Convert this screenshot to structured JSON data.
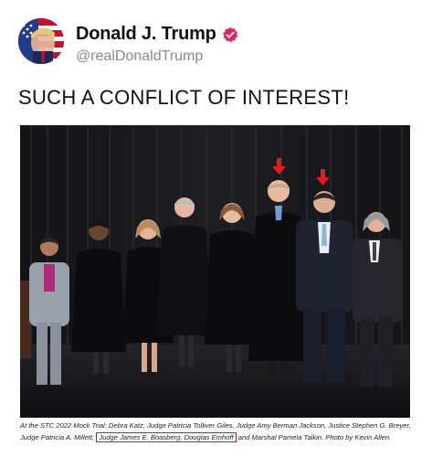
{
  "post": {
    "display_name": "Donald J. Trump",
    "handle": "@realDonaldTrump",
    "verified_icon": "verified-badge-icon",
    "text": "SUCH A CONFLICT OF INTEREST!"
  },
  "photo": {
    "marker_color": "#e21b1b",
    "caption_part1": "At the STC 2022 Mock Trial: Debra Katz, Judge Patricia Tolliver Giles, Judge Amy Berman Jackson, Justice Stephen G. Breyer,",
    "caption_part2": "Judge Patricia A. Millett,",
    "caption_highlight": "Judge James E. Boasberg, Douglas Emhoff",
    "caption_part3": "and Marshal Pamela Talkin. Photo by Kevin Allen."
  },
  "colors": {
    "verified": "#e0245e",
    "highlight_border": "#d21a1a"
  }
}
